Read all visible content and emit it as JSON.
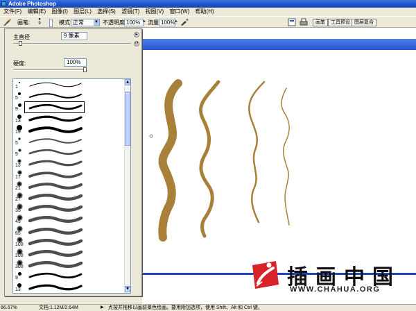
{
  "app": {
    "title": "Adobe Photoshop"
  },
  "menu": [
    "文件(F)",
    "编辑(E)",
    "图像(I)",
    "图层(L)",
    "选择(S)",
    "滤镜(T)",
    "视图(V)",
    "窗口(W)",
    "帮助(H)"
  ],
  "options": {
    "brush_label": "画笔:",
    "brush_size": "9",
    "mode_label": "模式:",
    "mode_value": "正常",
    "opacity_label": "不透明度:",
    "opacity_value": "100%",
    "flow_label": "流量:",
    "flow_value": "100%",
    "tabs": [
      "画笔",
      "工具预设",
      "图层复合"
    ]
  },
  "brush_panel": {
    "diameter_label": "主直径",
    "diameter_value": "9 像素",
    "diameter_level": 0.05,
    "hardness_label": "硬度:",
    "hardness_value": "100%",
    "hardness_level": 1.0,
    "brush_sizes": [
      "1",
      "5",
      "9",
      "13",
      "19",
      "5",
      "9",
      "13",
      "17",
      "21",
      "27",
      "35",
      "45",
      "65",
      "100",
      "200",
      "300",
      "9",
      "13"
    ],
    "selected_index": 2
  },
  "status": {
    "zoom": "66.67%",
    "doc": "文档:1.12M/2.64M",
    "hint": "点按并拖移以画前景色绘画。要用附加选项，使用 Shift、Alt 和 Ctrl 键。"
  },
  "watermark": {
    "title": "插画中国",
    "subtitle": "WWW.CHAHUA.ORG"
  },
  "colors": {
    "stroke": "#A8803A",
    "logo_red": "#D8222A",
    "titlebar": "#2456D2"
  }
}
